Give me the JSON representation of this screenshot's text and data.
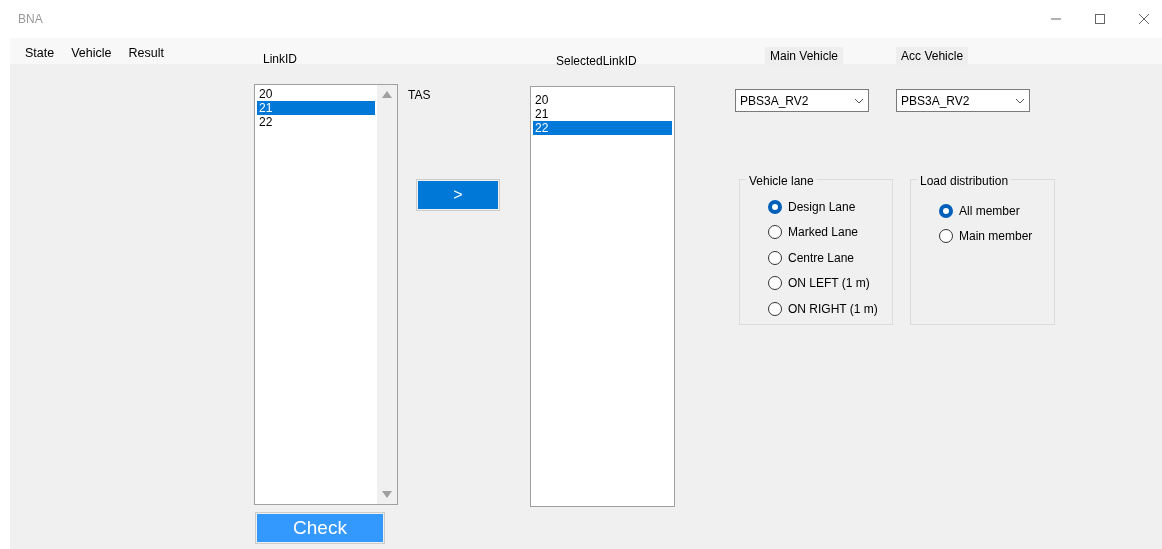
{
  "window": {
    "title": "BNA"
  },
  "menu": [
    {
      "label": "State"
    },
    {
      "label": "Vehicle"
    },
    {
      "label": "Result"
    }
  ],
  "link_list": {
    "label": "LinkID",
    "items": [
      {
        "text": "20",
        "selected": false
      },
      {
        "text": "21",
        "selected": true
      },
      {
        "text": "22",
        "selected": false
      }
    ]
  },
  "tas_label": "TAS",
  "add_button": ">",
  "check_button": "Check",
  "selected_list": {
    "label": "SelectedLinkID",
    "items": [
      {
        "text": "20",
        "selected": false
      },
      {
        "text": "21",
        "selected": false
      },
      {
        "text": "22",
        "selected": true
      }
    ]
  },
  "main_vehicle": {
    "label": "Main Vehicle",
    "value": "PBS3A_RV2"
  },
  "acc_vehicle": {
    "label": "Acc Vehicle",
    "value": "PBS3A_RV2"
  },
  "vehicle_lane": {
    "title": "Vehicle lane",
    "options": [
      {
        "label": "Design Lane",
        "selected": true
      },
      {
        "label": "Marked Lane",
        "selected": false
      },
      {
        "label": "Centre Lane",
        "selected": false
      },
      {
        "label": "ON LEFT (1 m)",
        "selected": false
      },
      {
        "label": "ON RIGHT (1 m)",
        "selected": false
      }
    ]
  },
  "load_distribution": {
    "title": "Load distribution",
    "options": [
      {
        "label": "All member",
        "selected": true
      },
      {
        "label": "Main member",
        "selected": false
      }
    ]
  }
}
